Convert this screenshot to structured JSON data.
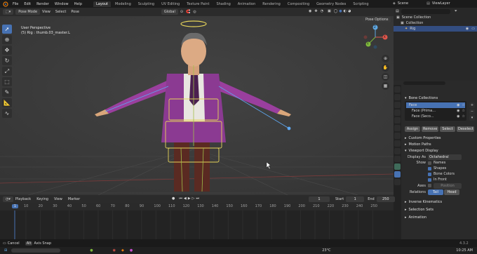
{
  "topbar": {
    "menu": [
      "File",
      "Edit",
      "Render",
      "Window",
      "Help"
    ],
    "workspaces": [
      "Layout",
      "Modeling",
      "Sculpting",
      "UV Editing",
      "Texture Paint",
      "Shading",
      "Animation",
      "Rendering",
      "Compositing",
      "Geometry Nodes",
      "Scripting"
    ],
    "active_workspace": "Layout",
    "scene": "Scene",
    "view_layer": "ViewLayer"
  },
  "viewport_header": {
    "mode": "Pose Mode",
    "menu": [
      "View",
      "Select",
      "Pose"
    ],
    "orientation": "Global",
    "pose_options": "Pose Options"
  },
  "viewport": {
    "overlay_line1": "User Perspective",
    "overlay_line2": "(5) Rig : thumb.03_master.L"
  },
  "gizmo": {
    "x": "X",
    "y": "Y",
    "z": "Z"
  },
  "outliner": {
    "search_placeholder": "",
    "items": [
      "Scene Collection",
      "Collection",
      "Rig"
    ]
  },
  "properties": {
    "bone_collections_title": "Bone Collections",
    "collections": [
      "Face",
      "Face (Prima...",
      "Face (Seco..."
    ],
    "assign": "Assign",
    "remove": "Remove",
    "select": "Select",
    "deselect": "Deselect",
    "sections": [
      "Custom Properties",
      "Motion Paths",
      "Viewport Display"
    ],
    "display_as_label": "Display As",
    "display_as_value": "Octahedral",
    "show_label": "Show",
    "show_options": [
      "Names",
      "Shapes",
      "Bone Colors",
      "In Front"
    ],
    "axes_label": "Axes",
    "axes_value": "Position",
    "relations_label": "Relations",
    "relations_options": [
      "Tail",
      "Head"
    ],
    "bottom_sections": [
      "Inverse Kinematics",
      "Selection Sets",
      "Animation"
    ]
  },
  "timeline_header": {
    "menu": [
      "Playback",
      "Keying",
      "View",
      "Marker"
    ],
    "current_frame": "1",
    "start_label": "Start",
    "start": "1",
    "end_label": "End",
    "end": "250"
  },
  "timeline": {
    "ticks": [
      "1",
      "10",
      "20",
      "30",
      "40",
      "50",
      "60",
      "70",
      "80",
      "90",
      "100",
      "110",
      "120",
      "130",
      "140",
      "150",
      "160",
      "170",
      "180",
      "190",
      "200",
      "210",
      "220",
      "230",
      "240",
      "250"
    ]
  },
  "statusbar": {
    "cancel": "Cancel",
    "alt": "Alt",
    "axis_snap": "Axis Snap",
    "version": "4.3.2"
  },
  "taskbar": {
    "weather": "23°C",
    "time": "10:25 AM"
  },
  "colors": {
    "accent": "#4772b3",
    "viewport_bg": "#3d3d3d",
    "panel_bg": "#2a2a2a"
  }
}
